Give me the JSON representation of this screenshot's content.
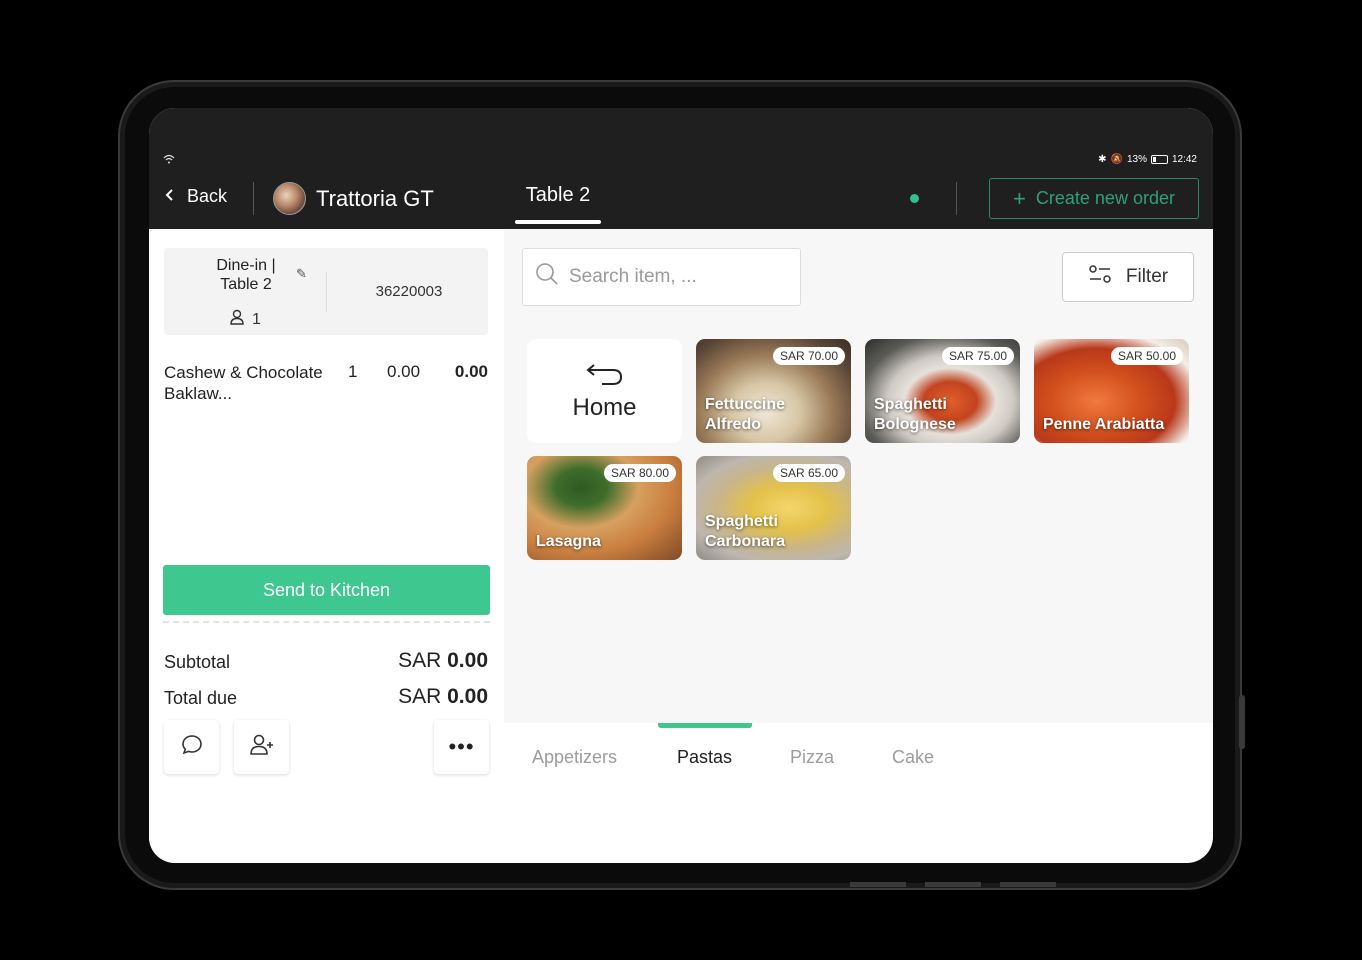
{
  "status_bar": {
    "battery": "13%",
    "time": "12:42"
  },
  "header": {
    "back_label": "Back",
    "restaurant_name": "Trattoria GT",
    "table_tab": "Table 2",
    "create_order_label": "Create new order",
    "accent_color": "#3ec78e"
  },
  "order": {
    "type_line1": "Dine-in |",
    "type_line2": "Table 2",
    "order_number": "36220003",
    "guests": "1",
    "items": [
      {
        "name": "Cashew & Chocolate Baklaw...",
        "qty": "1",
        "price": "0.00",
        "total": "0.00"
      }
    ],
    "send_label": "Send to Kitchen",
    "subtotal_label": "Subtotal",
    "subtotal_currency": "SAR",
    "subtotal_value": "0.00",
    "total_label": "Total due",
    "total_currency": "SAR",
    "total_value": "0.00"
  },
  "menu": {
    "search_placeholder": "Search item, ...",
    "filter_label": "Filter",
    "home_label": "Home",
    "items": [
      {
        "name": "Fettuccine Alfredo",
        "price": "SAR 70.00"
      },
      {
        "name": "Spaghetti Bolognese",
        "price": "SAR 75.00"
      },
      {
        "name": "Penne Arabiatta",
        "price": "SAR 50.00"
      },
      {
        "name": "Lasagna",
        "price": "SAR 80.00"
      },
      {
        "name": "Spaghetti Carbonara",
        "price": "SAR 65.00"
      }
    ],
    "categories": [
      "Appetizers",
      "Pastas",
      "Pizza",
      "Cake"
    ],
    "active_category": "Pastas"
  }
}
